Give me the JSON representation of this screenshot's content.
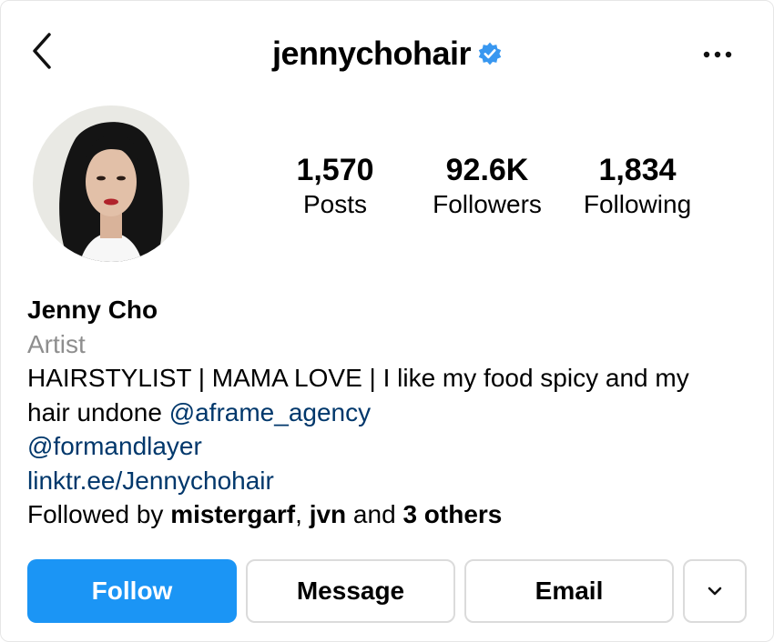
{
  "header": {
    "username": "jennychohair",
    "back_icon": "chevron-left-icon",
    "verified_icon": "verified-badge-icon",
    "more_icon": "more-horizontal-icon"
  },
  "stats": [
    {
      "value": "1,570",
      "label": "Posts"
    },
    {
      "value": "92.6K",
      "label": "Followers"
    },
    {
      "value": "1,834",
      "label": "Following"
    }
  ],
  "bio": {
    "name": "Jenny Cho",
    "category": "Artist",
    "text_line1": "HAIRSTYLIST | MAMA LOVE | I like my food spicy and my",
    "text_line2": "hair undone ",
    "mention1": "@aframe_agency",
    "mention2": "@formandlayer",
    "website": "linktr.ee/Jennychohair",
    "followed_by_prefix": "Followed by ",
    "followed_by_user1": "mistergarf",
    "followed_by_sep": ", ",
    "followed_by_user2": "jvn",
    "followed_by_and": " and ",
    "followed_by_others": "3 others"
  },
  "buttons": {
    "follow": "Follow",
    "message": "Message",
    "email": "Email",
    "dropdown_icon": "chevron-down-icon"
  },
  "colors": {
    "follow_button": "#1b95f5",
    "link": "#00376b",
    "category": "#8e8e8e",
    "verified": "#3897f0"
  }
}
